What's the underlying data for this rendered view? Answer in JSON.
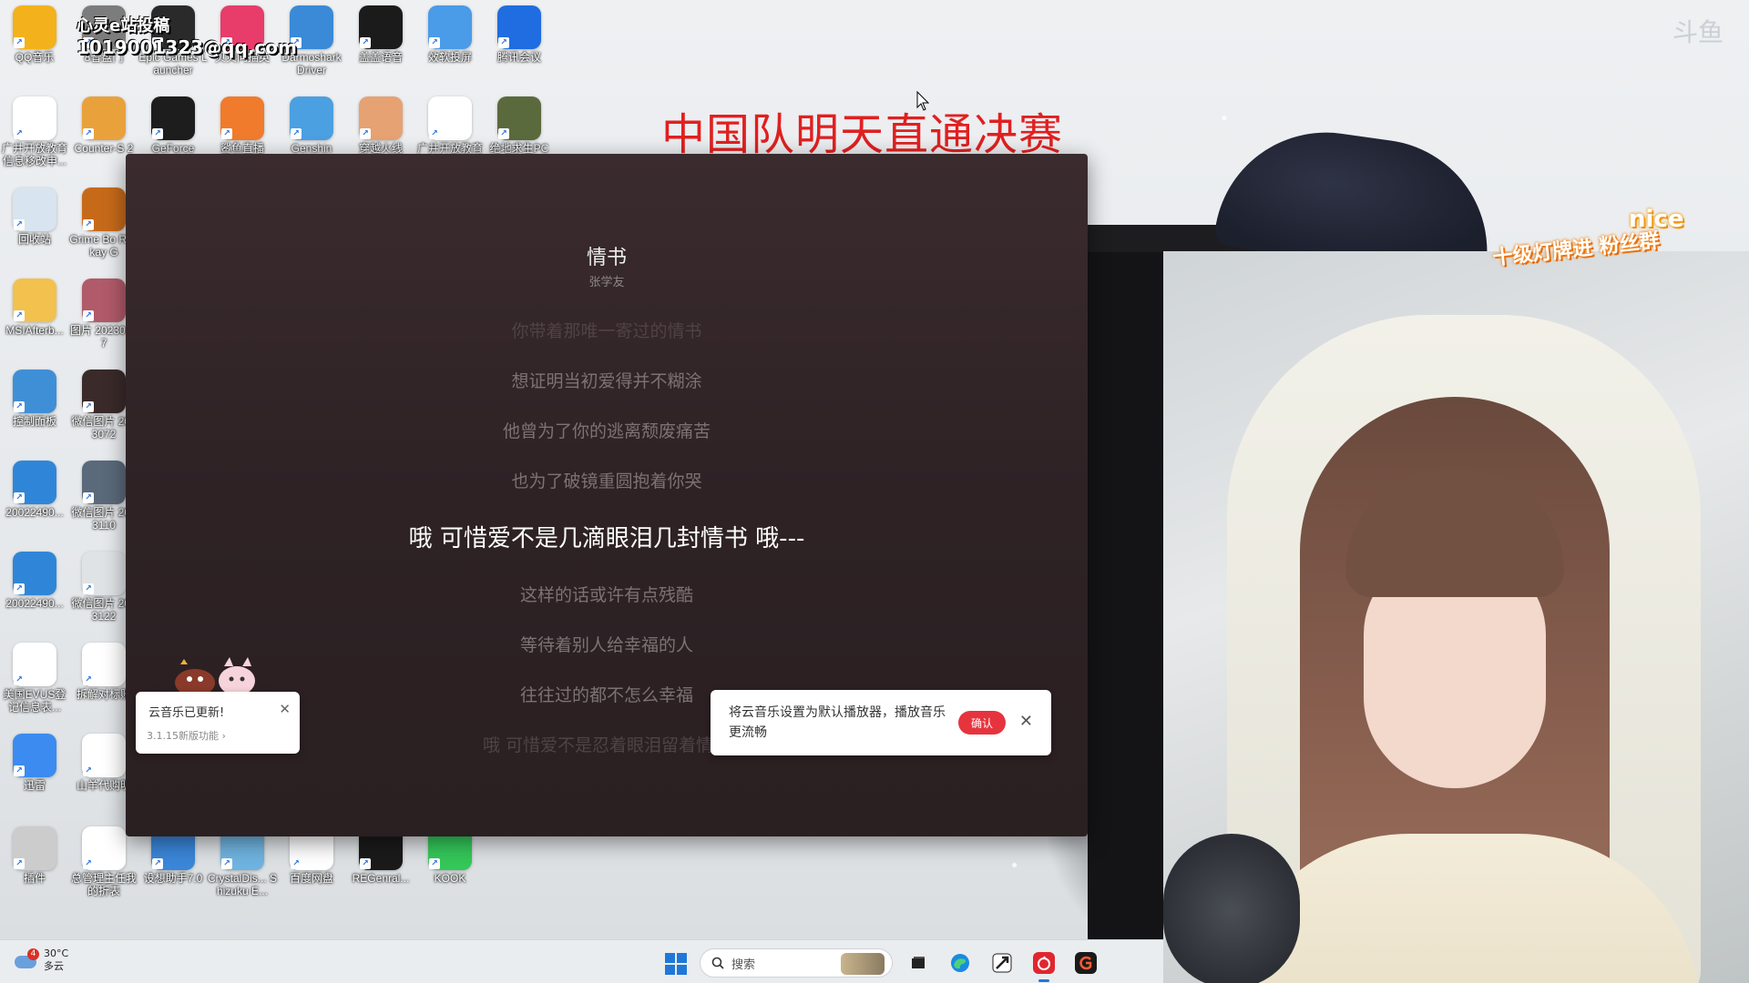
{
  "overlay": {
    "headline": "中国队明天直通决赛",
    "email_line1": "心灵e站投稿",
    "email_line2": "1019001323@qq.com",
    "watermark": "斗鱼",
    "sticker_nice": "nice",
    "sticker_group": "十级灯牌进 粉丝群"
  },
  "desktop_icons": [
    {
      "label": "QQ音乐",
      "icon": "mail-icon",
      "color": "#f3b21b"
    },
    {
      "label": "8音盘门",
      "icon": "app-icon",
      "color": "#7c7c7c"
    },
    {
      "label": "Epic Games Launcher",
      "icon": "epic-icon",
      "color": "#2a2a2a"
    },
    {
      "label": "贝贝问描英",
      "icon": "play-icon",
      "color": "#e83c6a"
    },
    {
      "label": "Darmoshark Driver",
      "icon": "shark-icon",
      "color": "#3a8ad8"
    },
    {
      "label": "盖盖语音",
      "icon": "v-icon",
      "color": "#1b1b1b"
    },
    {
      "label": "效软投屏",
      "icon": "mountain-icon",
      "color": "#4a9be8"
    },
    {
      "label": "腾讯会议",
      "icon": "meeting-icon",
      "color": "#1f6de0"
    },
    {
      "label": "广井开放教育 信息移改申...",
      "icon": "word-icon",
      "color": "#ffffff"
    },
    {
      "label": "Counter-S 2",
      "icon": "cs-icon",
      "color": "#e9a13c"
    },
    {
      "label": "GeForce",
      "icon": "nvidia-icon",
      "color": "#1d1d1d"
    },
    {
      "label": "鲨鱼直播",
      "icon": "shark-app-icon",
      "color": "#f07b2c"
    },
    {
      "label": "Genshin",
      "icon": "globe-icon",
      "color": "#4aa0e0"
    },
    {
      "label": "穿越火线",
      "icon": "character-icon",
      "color": "#e6a272"
    },
    {
      "label": "广井开放教育",
      "icon": "word-icon",
      "color": "#ffffff"
    },
    {
      "label": "绝地求生PC",
      "icon": "pubg-icon",
      "color": "#5a6a3c"
    },
    {
      "label": "回收站",
      "icon": "recycle-bin-icon",
      "color": "#d8e4ef"
    },
    {
      "label": "Grime Bo Rockay G",
      "icon": "skull-icon",
      "color": "#c66a1a"
    },
    {
      "label": "MSIAfterb...",
      "icon": "folder-icon",
      "color": "#f2c14e"
    },
    {
      "label": "图片 20230427",
      "icon": "photo-icon",
      "color": "#b15a6a"
    },
    {
      "label": "控制面板",
      "icon": "control-panel-icon",
      "color": "#3f8fd6"
    },
    {
      "label": "微信图片 2023072",
      "icon": "photo-icon",
      "color": "#3a2a2a"
    },
    {
      "label": "20022490...",
      "icon": "zip-icon",
      "color": "#2f86d8"
    },
    {
      "label": "微信图片 2023110",
      "icon": "photo-icon",
      "color": "#5a6a7a"
    },
    {
      "label": "20022490...",
      "icon": "zip-icon",
      "color": "#2f86d8"
    },
    {
      "label": "微信图片 2023122",
      "icon": "photo-icon",
      "color": "#dfe3e6"
    },
    {
      "label": "美国EVUS登 记信息表...",
      "icon": "word-icon",
      "color": "#ffffff"
    },
    {
      "label": "拆解对标账",
      "icon": "sheet-icon",
      "color": "#ffffff"
    },
    {
      "label": "迅雷",
      "icon": "bird-icon",
      "color": "#3b8bf0"
    },
    {
      "label": "山羊代购明",
      "icon": "sheet-icon",
      "color": "#ffffff"
    },
    {
      "label": "插件",
      "icon": "dash-icon",
      "color": "#cccccc"
    },
    {
      "label": "总管理主任我 的折表",
      "icon": "sheet-icon",
      "color": "#ffffff"
    },
    {
      "label": "设想助手7.0",
      "icon": "u-icon",
      "color": "#3a86d8"
    },
    {
      "label": "CrystalDis... Shizuku E...",
      "icon": "crystal-icon",
      "color": "#6fb3e0"
    },
    {
      "label": "百度网盘",
      "icon": "cloud-icon",
      "color": "#ffffff"
    },
    {
      "label": "REGenral...",
      "icon": "swirl-icon",
      "color": "#1a1a1a"
    },
    {
      "label": "KOOK",
      "icon": "kook-icon",
      "color": "#34c759"
    }
  ],
  "player": {
    "title": "情书",
    "artist": "张学友",
    "lyrics": [
      {
        "text": "你带着那唯一寄过的情书",
        "state": "faint"
      },
      {
        "text": "想证明当初爱得并不糊涂",
        "state": "normal"
      },
      {
        "text": "他曾为了你的逃离颓废痛苦",
        "state": "normal"
      },
      {
        "text": "也为了破镜重圆抱着你哭",
        "state": "normal"
      },
      {
        "text": "哦 可惜爱不是几滴眼泪几封情书 哦---",
        "state": "current"
      },
      {
        "text": "这样的话或许有点残酷",
        "state": "normal"
      },
      {
        "text": "等待着别人给幸福的人",
        "state": "normal"
      },
      {
        "text": "往往过的都不怎么幸福",
        "state": "normal"
      },
      {
        "text": "哦 可惜爱不是忍着眼泪留着情书",
        "state": "faint"
      }
    ]
  },
  "notification_update": {
    "title": "云音乐已更新!",
    "subtitle": "3.1.15新版功能 ›",
    "close": "✕"
  },
  "notification_default": {
    "message": "将云音乐设置为默认播放器，播放音乐更流畅",
    "confirm": "确认",
    "close": "✕"
  },
  "taskbar": {
    "weather_temp": "30°C",
    "weather_desc": "多云",
    "weather_badge": "4",
    "search_placeholder": "搜索",
    "apps": [
      "task-view-icon",
      "edge-icon",
      "steam-icon",
      "netease-music-icon",
      "app-g-icon"
    ]
  }
}
